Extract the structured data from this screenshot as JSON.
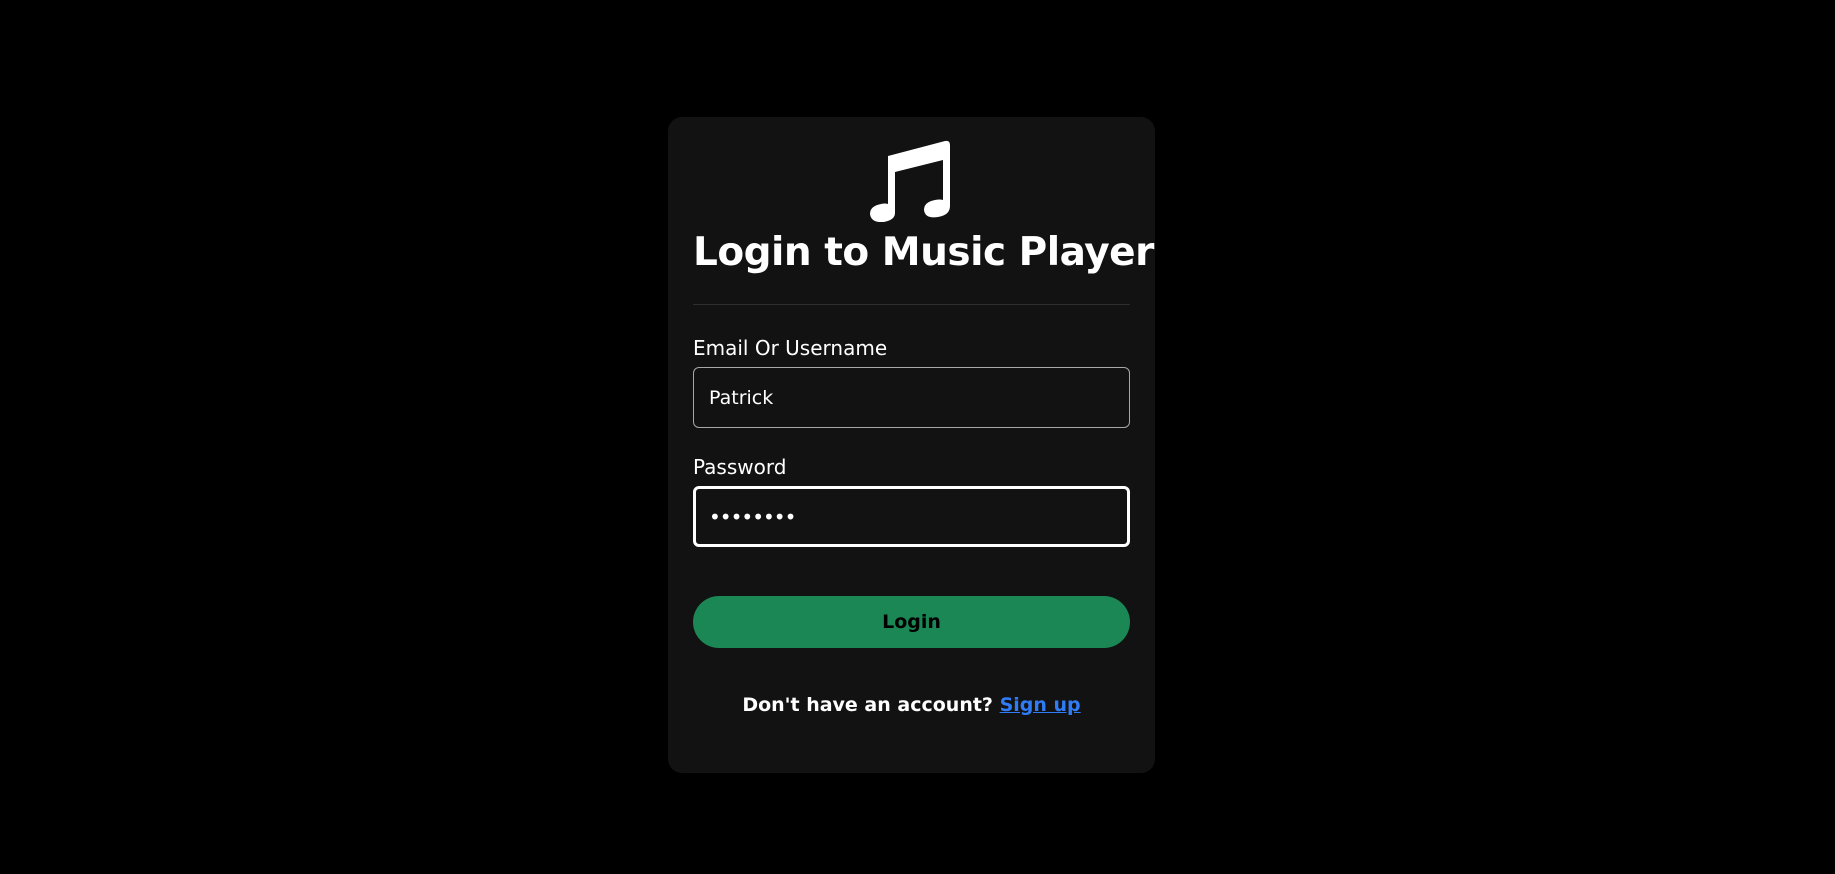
{
  "login_card": {
    "icon": "music-note-icon",
    "title": "Login to Music Player",
    "email_field": {
      "label": "Email Or Username",
      "value": "Patrick"
    },
    "password_field": {
      "label": "Password",
      "value": "••••••••"
    },
    "login_button_label": "Login",
    "signup_prompt": "Don't have an account?",
    "signup_link_label": "Sign up"
  },
  "colors": {
    "background": "#000000",
    "card": "#121212",
    "accent": "#1b8754",
    "link": "#2f7cf6"
  }
}
